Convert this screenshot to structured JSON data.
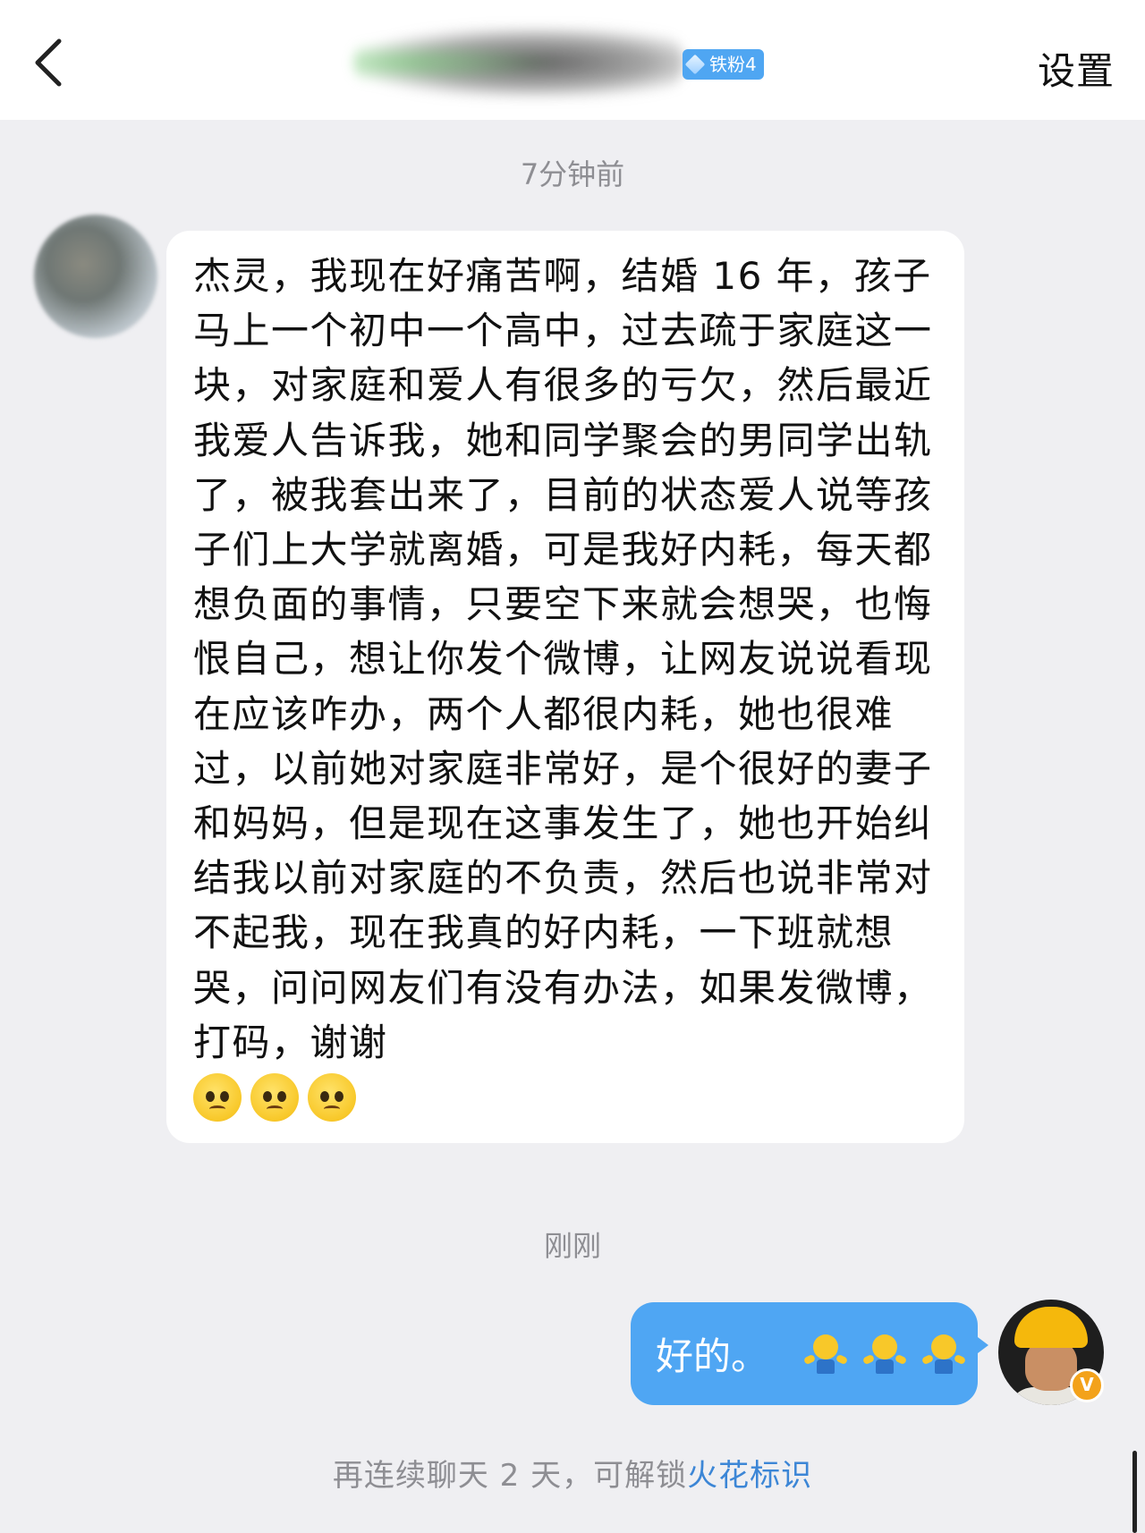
{
  "header": {
    "back_icon": "chevron-left-icon",
    "fan_badge": "铁粉4",
    "settings_label": "设置"
  },
  "messages": {
    "timestamp_1": "7分钟前",
    "incoming_text": "杰灵，我现在好痛苦啊，结婚 16 年，孩子马上一个初中一个高中，过去疏于家庭这一块，对家庭和爱人有很多的亏欠，然后最近我爱人告诉我，她和同学聚会的男同学出轨了，被我套出来了，目前的状态爱人说等孩子们上大学就离婚，可是我好内耗，每天都想负面的事情，只要空下来就会想哭，也悔恨自己，想让你发个微博，让网友说说看现在应该咋办，两个人都很内耗，她也很难过，以前她对家庭非常好，是个很好的妻子和妈妈，但是现在这事发生了，她也开始纠结我以前对家庭的不负责，然后也说非常对不起我，现在我真的好内耗，一下班就想哭，问问网友们有没有办法，如果发微博，打码，谢谢",
    "incoming_emojis": [
      "sad-emoji",
      "sad-emoji",
      "sad-emoji"
    ],
    "timestamp_2": "刚刚",
    "outgoing_text": "好的。",
    "outgoing_emojis": [
      "shrug-emoji",
      "shrug-emoji",
      "shrug-emoji"
    ]
  },
  "footer": {
    "hint_prefix": "再连续聊天 2 天，可解锁",
    "hint_link": "火花标识"
  },
  "colors": {
    "background": "#efeff2",
    "outgoing_bubble": "#4fa6f3",
    "link": "#3c86d6",
    "fan_badge": "#4fa6f2"
  }
}
